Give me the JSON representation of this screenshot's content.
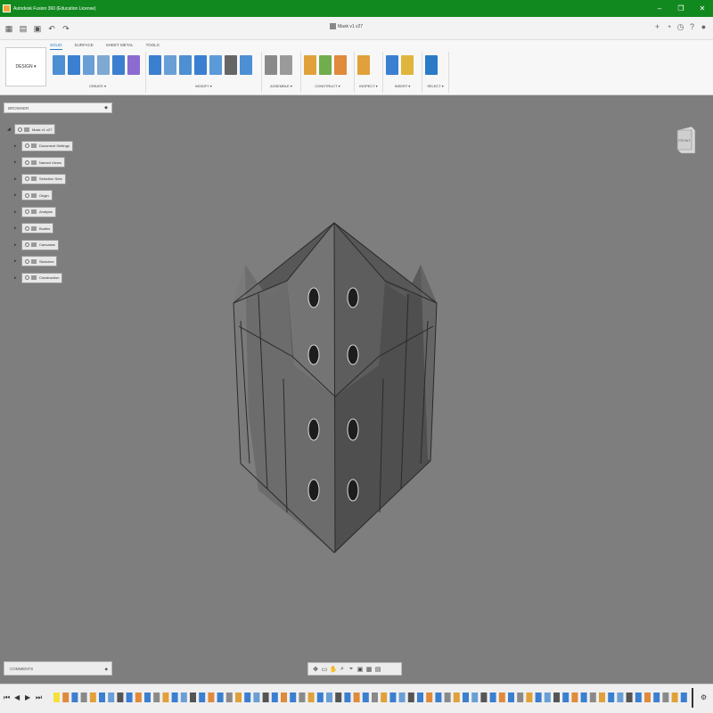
{
  "window": {
    "title": "Autodesk Fusion 360 (Education License)",
    "controls": [
      "–",
      "❐",
      "✕"
    ]
  },
  "quick_access": {
    "document_title": "Mask v1 v27"
  },
  "ribbon": {
    "workspace_button": "DESIGN ▾",
    "tabs": [
      {
        "label": "SOLID",
        "active": true
      },
      {
        "label": "SURFACE",
        "active": false
      },
      {
        "label": "SHEET METAL",
        "active": false
      },
      {
        "label": "TOOLS",
        "active": false
      }
    ],
    "groups": [
      {
        "label": "CREATE ▾",
        "tools": [
          "#4c8fd3",
          "#3b7fd0",
          "#6a9fd6",
          "#7fa8d3",
          "#3b7fd0",
          "#8b6bd0"
        ]
      },
      {
        "label": "MODIFY ▾",
        "tools": [
          "#3b7fd0",
          "#6a9fd6",
          "#4c8fd3",
          "#3b7fd0",
          "#5a9ad8",
          "#666666",
          "#4c8fd3"
        ]
      },
      {
        "label": "ASSEMBLE ▾",
        "tools": [
          "#8a8a8a",
          "#9a9a9a"
        ]
      },
      {
        "label": "CONSTRUCT ▾",
        "tools": [
          "#e0a13b",
          "#6fae4b",
          "#e08a3b"
        ]
      },
      {
        "label": "INSPECT ▾",
        "tools": [
          "#e0a13b"
        ]
      },
      {
        "label": "INSERT ▾",
        "tools": [
          "#3b7fd0",
          "#e0b53b"
        ]
      },
      {
        "label": "SELECT ▾",
        "tools": [
          "#2a7ac7"
        ]
      }
    ]
  },
  "browser": {
    "header": "BROWSER",
    "root": "Mask v1 v27",
    "items": [
      {
        "label": "Document Settings"
      },
      {
        "label": "Named Views"
      },
      {
        "label": "Selection Sets"
      },
      {
        "label": "Origin"
      },
      {
        "label": "Analysis"
      },
      {
        "label": "Bodies"
      },
      {
        "label": "Canvases"
      },
      {
        "label": "Sketches"
      },
      {
        "label": "Construction"
      }
    ]
  },
  "viewcube": {
    "face_label": "FRONT"
  },
  "comments": {
    "label": "COMMENTS"
  },
  "colors": {
    "titlebar": "#12891f",
    "viewport": "#7e7e7e",
    "accent": "#2a7ac7"
  }
}
